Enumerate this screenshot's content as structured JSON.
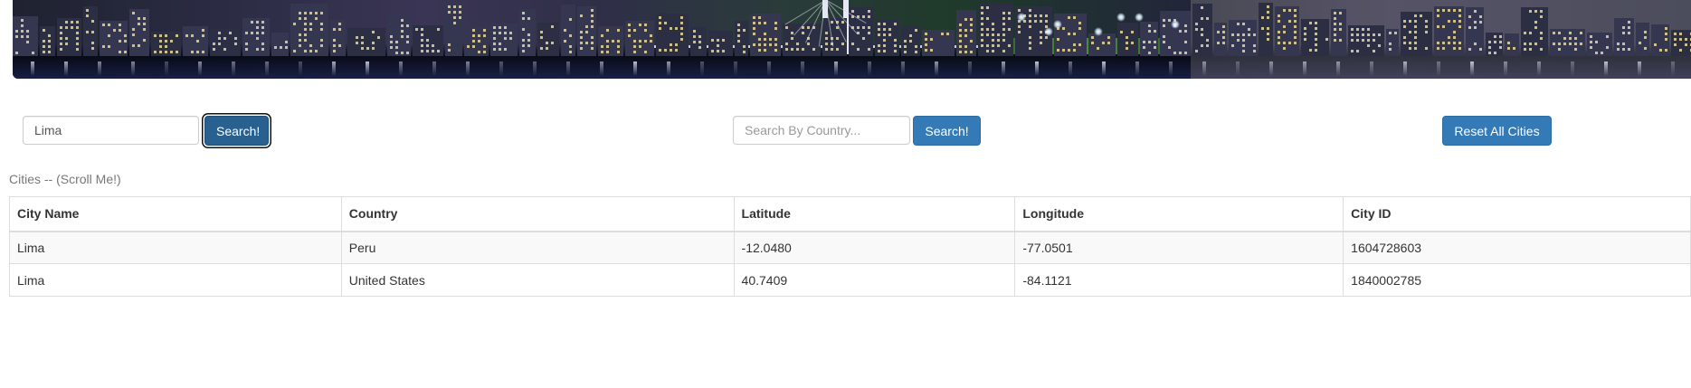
{
  "search_city": {
    "value": "Lima",
    "button_label": "Search!"
  },
  "search_country": {
    "placeholder": "Search By Country...",
    "value": "",
    "button_label": "Search!"
  },
  "reset_button_label": "Reset All Cities",
  "table": {
    "caption": "Cities -- (Scroll Me!)",
    "columns": [
      "City Name",
      "Country",
      "Latitude",
      "Longitude",
      "City ID"
    ],
    "rows": [
      [
        "Lima",
        "Peru",
        "-12.0480",
        "-77.0501",
        "1604728603"
      ],
      [
        "Lima",
        "United States",
        "40.7409",
        "-84.1121",
        "1840002785"
      ]
    ]
  },
  "colors": {
    "primary_button": "#337ab7",
    "primary_button_active": "#286090"
  }
}
